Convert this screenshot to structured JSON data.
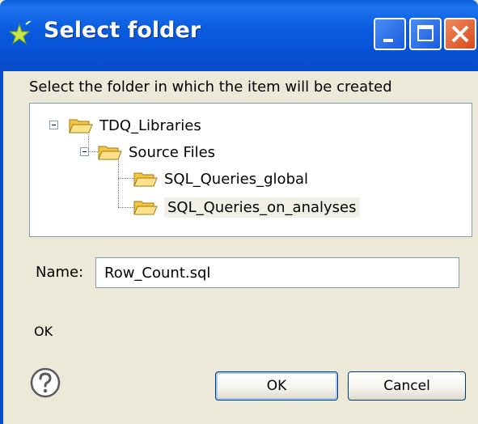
{
  "window": {
    "title": "Select folder",
    "icon": "green-star-wand-icon"
  },
  "titlebar_buttons": [
    "minimize-icon",
    "maximize-icon",
    "close-icon"
  ],
  "instruction": "Select the folder in which the item will be created",
  "tree": {
    "items": [
      {
        "label": "TDQ_Libraries",
        "level": 0,
        "expanded": true
      },
      {
        "label": "Source Files",
        "level": 1,
        "expanded": true
      },
      {
        "label": "SQL_Queries_global",
        "level": 2
      },
      {
        "label": "SQL_Queries_on_analyses",
        "level": 2,
        "selected": true
      }
    ]
  },
  "name_field": {
    "label": "Name:",
    "value": "Row_Count.sql"
  },
  "status_text": "OK",
  "buttons": {
    "ok": "OK",
    "cancel": "Cancel"
  },
  "help_icon": "question-mark-icon",
  "colors": {
    "titlebar": "#0a5ce0",
    "dialog_bg": "#ece9d8",
    "close_button": "#d84a1a",
    "folder": "#f5c542"
  }
}
